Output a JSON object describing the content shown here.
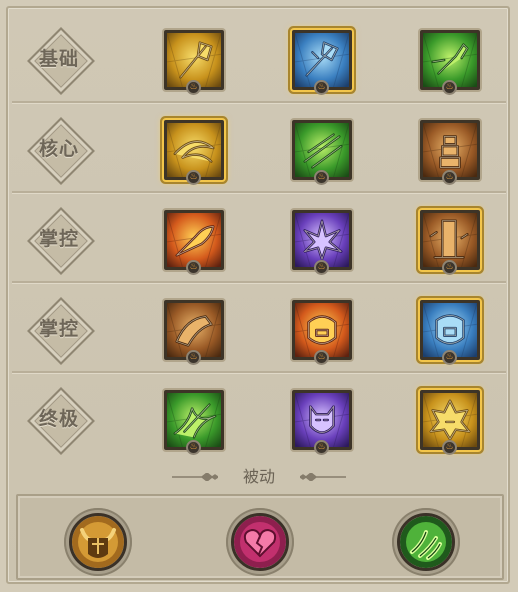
{
  "tiers": [
    {
      "label": "基础",
      "skills": [
        {
          "icon": "golden-axe-icon",
          "selected": false
        },
        {
          "icon": "ice-axe-icon",
          "selected": true
        },
        {
          "icon": "green-gauntlet-icon",
          "selected": false
        }
      ]
    },
    {
      "label": "核心",
      "skills": [
        {
          "icon": "golden-whirlwind-icon",
          "selected": true
        },
        {
          "icon": "green-slash-icon",
          "selected": false
        },
        {
          "icon": "earth-totem-icon",
          "selected": false
        }
      ]
    },
    {
      "label": "掌控",
      "skills": [
        {
          "icon": "fire-dash-icon",
          "selected": false
        },
        {
          "icon": "arcane-burst-icon",
          "selected": false
        },
        {
          "icon": "earth-pillar-icon",
          "selected": true
        }
      ]
    },
    {
      "label": "掌控",
      "skills": [
        {
          "icon": "earth-strike-icon",
          "selected": false
        },
        {
          "icon": "fire-roar-icon",
          "selected": false
        },
        {
          "icon": "ice-roar-icon",
          "selected": true
        }
      ]
    },
    {
      "label": "终极",
      "skills": [
        {
          "icon": "green-cyclone-icon",
          "selected": false
        },
        {
          "icon": "arcane-demon-icon",
          "selected": false
        },
        {
          "icon": "golden-avatar-icon",
          "selected": true
        }
      ]
    }
  ],
  "passive_label": "被动",
  "passives": [
    {
      "icon": "horned-helmet-icon"
    },
    {
      "icon": "broken-heart-icon"
    },
    {
      "icon": "green-claw-icon"
    }
  ],
  "gem_glyph": "♨",
  "colors": {
    "gold": "#e1b430",
    "ice": "#5aa3d6",
    "nature": "#4fb23a",
    "earth": "#a86a35",
    "fire": "#e0702a",
    "arcane": "#7b55c9",
    "select_glow": "#f3c64b",
    "heart": "#c2306e"
  }
}
